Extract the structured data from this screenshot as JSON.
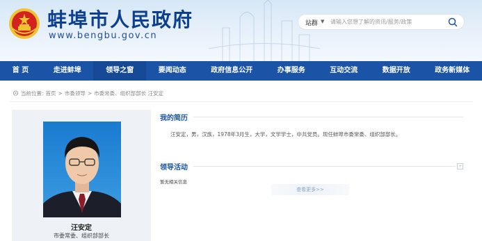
{
  "header": {
    "title": "蚌埠市人民政府",
    "domain": "www.bengbu.gov.cn"
  },
  "search": {
    "scope": "站群",
    "placeholder": "请输入您想了解的资讯/服务/政策"
  },
  "nav": {
    "items": [
      {
        "label": "首 页"
      },
      {
        "label": "走进蚌埠"
      },
      {
        "label": "领导之窗"
      },
      {
        "label": "要闻动态"
      },
      {
        "label": "政府信息公开"
      },
      {
        "label": "办事服务"
      },
      {
        "label": "互动交流"
      },
      {
        "label": "数据开放"
      },
      {
        "label": "政务新媒体"
      }
    ]
  },
  "breadcrumb": {
    "prefix": "当前位置:",
    "items": [
      "首页",
      "市委领导",
      "市委常委、组织部部长 汪安定"
    ],
    "separator": ">"
  },
  "profile": {
    "name": "汪安定",
    "position": "市委常委、组织部部长"
  },
  "bio": {
    "heading": "我的简历",
    "text": "汪安定，男，汉族，1978年3月生，大学，文学学士，中共党员。现任蚌埠市委常委、组织部部长。"
  },
  "activities": {
    "heading": "领导活动",
    "empty_text": "暂无相关信息",
    "more_label": "查看更多>>"
  },
  "colors": {
    "nav_bg": "#1b54a6",
    "title_blue": "#0d3f8f",
    "section_blue": "#1b54a6",
    "emblem_red": "#d2231e",
    "emblem_gold": "#f1c232"
  }
}
